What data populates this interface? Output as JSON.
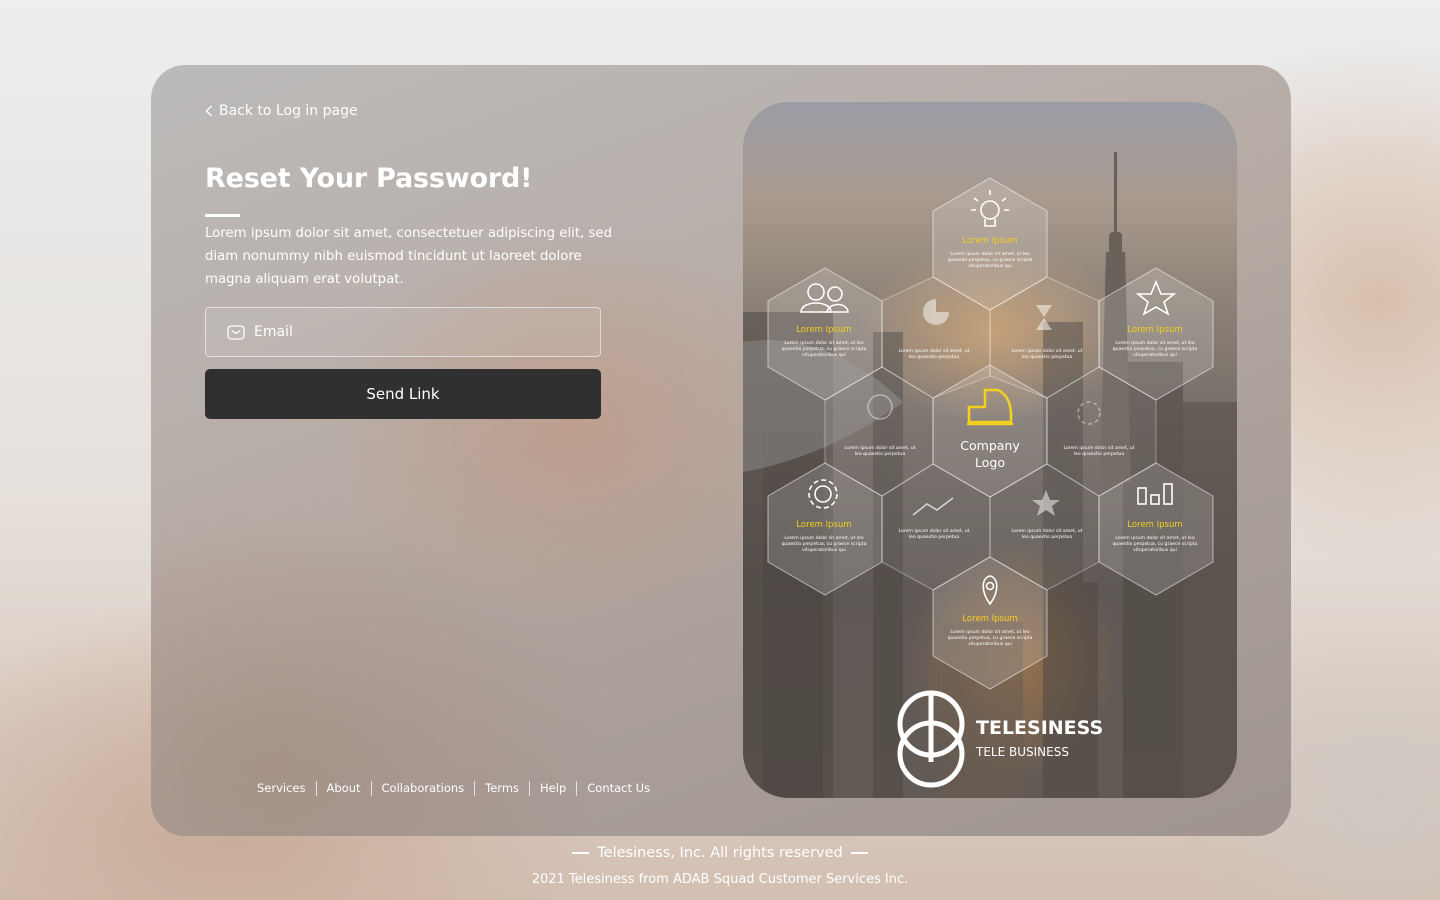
{
  "back_link": {
    "label": "Back to Log in page"
  },
  "form": {
    "title": "Reset Your Password!",
    "description": "Lorem ipsum dolor sit amet, consectetuer adipiscing elit, sed diam nonummy nibh euismod tincidunt ut laoreet dolore magna aliquam erat volutpat.",
    "email_placeholder": "Email",
    "email_value": "",
    "submit_label": "Send Link"
  },
  "footer_nav": [
    "Services",
    "About",
    "Collaborations",
    "Terms",
    "Help",
    "Contact Us"
  ],
  "hero": {
    "center_label": "Company\nLogo",
    "hexes": [
      {
        "icon": "lightbulb-icon",
        "title": "Lorem Ipsum",
        "lines": [
          "Lorem ipsum dolor sit amet, ut leo",
          "quaestio perpetua, cu graece scripta",
          "vituperatoribus qui"
        ]
      },
      {
        "icon": "users-icon",
        "title": "Lorem Ipsum",
        "lines": [
          "Lorem ipsum dolor sit amet, ut leo",
          "quaestio perpetua, cu graece scripta",
          "vituperatoribus qui"
        ]
      },
      {
        "icon": "star-icon",
        "title": "Lorem Ipsum",
        "lines": [
          "Lorem ipsum dolor sit amet, ut leo",
          "quaestio perpetua, cu graece scripta",
          "vituperatoribus qui"
        ]
      },
      {
        "icon": "gear-icon",
        "title": "Lorem Ipsum",
        "lines": [
          "Lorem ipsum dolor sit amet, ut leo",
          "quaestio perpetua, cu graece scripta",
          "vituperatoribus qui"
        ]
      },
      {
        "icon": "bar-chart-icon",
        "title": "Lorem Ipsum",
        "lines": [
          "Lorem ipsum dolor sit amet, ut leo",
          "quaestio perpetua, cu graece scripta",
          "vituperatoribus qui"
        ]
      },
      {
        "icon": "location-pin-icon",
        "title": "Lorem Ipsum",
        "lines": [
          "Lorem ipsum dolor sit amet, ut leo",
          "quaestio perpetua, cu graece scripta",
          "vituperatoribus qui"
        ]
      }
    ],
    "small_text_lines": [
      "Lorem ipsum dolor sit amet, ut",
      "leo quaestio perpetua"
    ],
    "brand_name": "TELESINESS",
    "brand_sub": "TELE BUSINESS"
  },
  "copyright": {
    "main": "Telesiness, Inc. All rights reserved",
    "sub": "2021 Telesiness from ADAB Squad Customer Services Inc."
  },
  "colors": {
    "accent_yellow": "#f3cf1e",
    "button_dark": "#303030"
  }
}
